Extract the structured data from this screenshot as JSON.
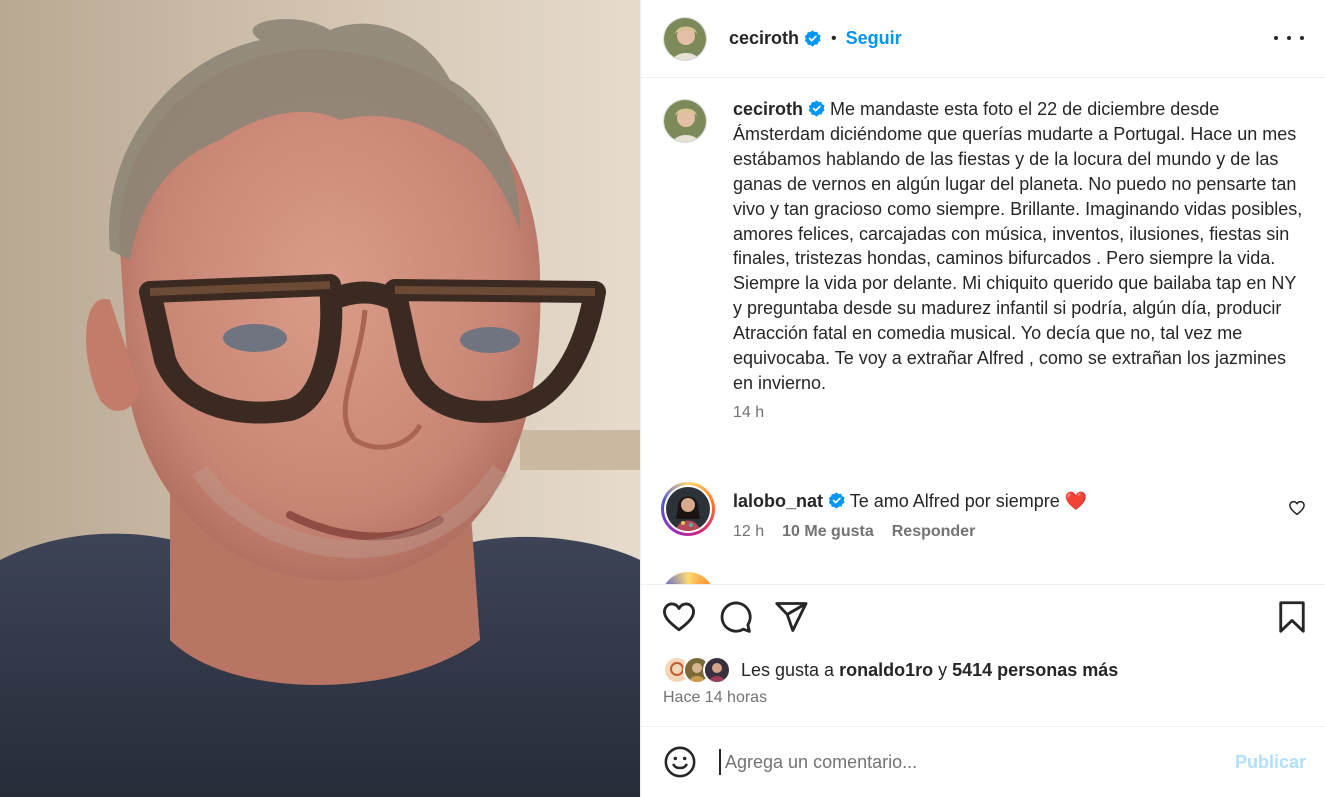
{
  "post": {
    "author": "ceciroth",
    "follow_label": "Seguir",
    "separator": "•",
    "more_icon": "ellipsis-horizontal-icon",
    "caption": "Me mandaste esta foto el 22 de diciembre desde Ámsterdam diciéndome que querías mudarte a Portugal. Hace un mes estábamos hablando de las fiestas y de la locura del mundo y de las ganas de vernos en algún lugar del planeta. No puedo no pensarte tan vivo y tan gracioso como siempre. Brillante. Imaginando vidas posibles, amores felices, carcajadas con música, inventos, ilusiones, fiestas sin finales, tristezas hondas, caminos bifurcados . Pero siempre la vida. Siempre la vida por delante. Mi chiquito querido que bailaba tap en NY y preguntaba desde su madurez infantil si podría, algún día, producir Atracción fatal en comedia musical. Yo decía que no, tal vez me equivocaba. Te voy a extrañar Alfred , como se extrañan los jazmines en invierno.",
    "caption_time": "14 h"
  },
  "comments": [
    {
      "username": "lalobo_nat",
      "text": "Te amo Alfred por siempre",
      "emoji": "❤️",
      "time": "12 h",
      "likes": "10 Me gusta",
      "reply_label": "Responder"
    }
  ],
  "likes": {
    "prefix": "Les gusta a",
    "user": "ronaldo1ro",
    "connector": "y",
    "others": "5414 personas más"
  },
  "posted_ago": "Hace 14 horas",
  "composer": {
    "placeholder": "Agrega un comentario...",
    "publish_label": "Publicar"
  },
  "colors": {
    "accent": "#0095f6",
    "publish_disabled": "#b2dffc",
    "secondary_text": "#737373",
    "heart_red": "#ed4956"
  }
}
